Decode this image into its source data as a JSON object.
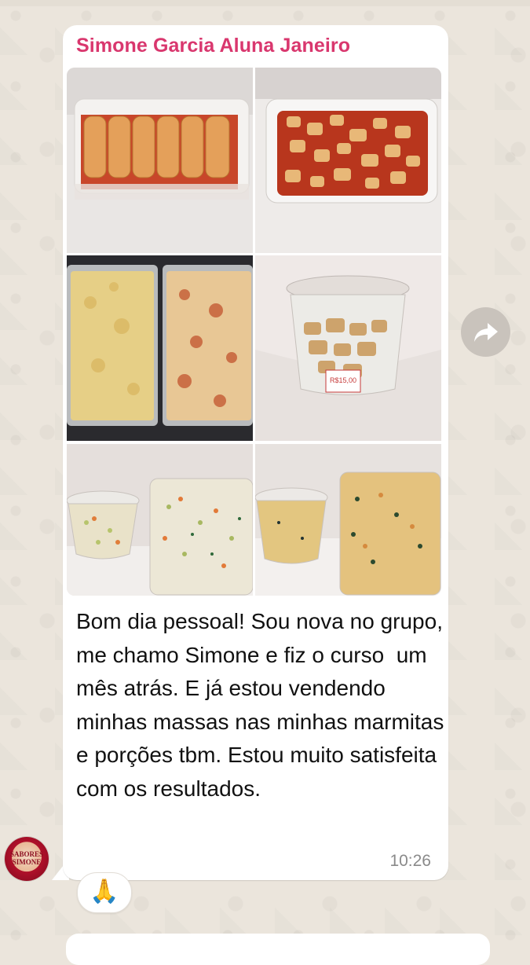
{
  "chat": {
    "sender_name": "Simone Garcia Aluna Janeiro",
    "message": "Bom dia pessoal! Sou nova no grupo, me chamo Simone e fiz o curso  um mês atrás. E já estou vendendo minhas massas nas minhas marmitas e porções tbm. Estou muito satisfeita com os resultados.",
    "time": "10:26",
    "reaction": "🙏",
    "avatar": {
      "label_line1": "SABORES",
      "label_line2": "SIMONE",
      "icon": "avatar-logo"
    }
  },
  "photos": [
    {
      "name": "photo-cannelloni"
    },
    {
      "name": "photo-gnocchi-sauce"
    },
    {
      "name": "photo-lasagna-trays"
    },
    {
      "name": "photo-pot-container",
      "price_tag": "R$15,00"
    },
    {
      "name": "photo-salad-containers-1"
    },
    {
      "name": "photo-salad-containers-2"
    }
  ],
  "colors": {
    "sender": "#d9376e",
    "bubble": "#ffffff",
    "wallpaper": "#ebe5dc",
    "time": "#8a8a8a"
  },
  "icons": {
    "forward": "forward-arrow-icon"
  }
}
